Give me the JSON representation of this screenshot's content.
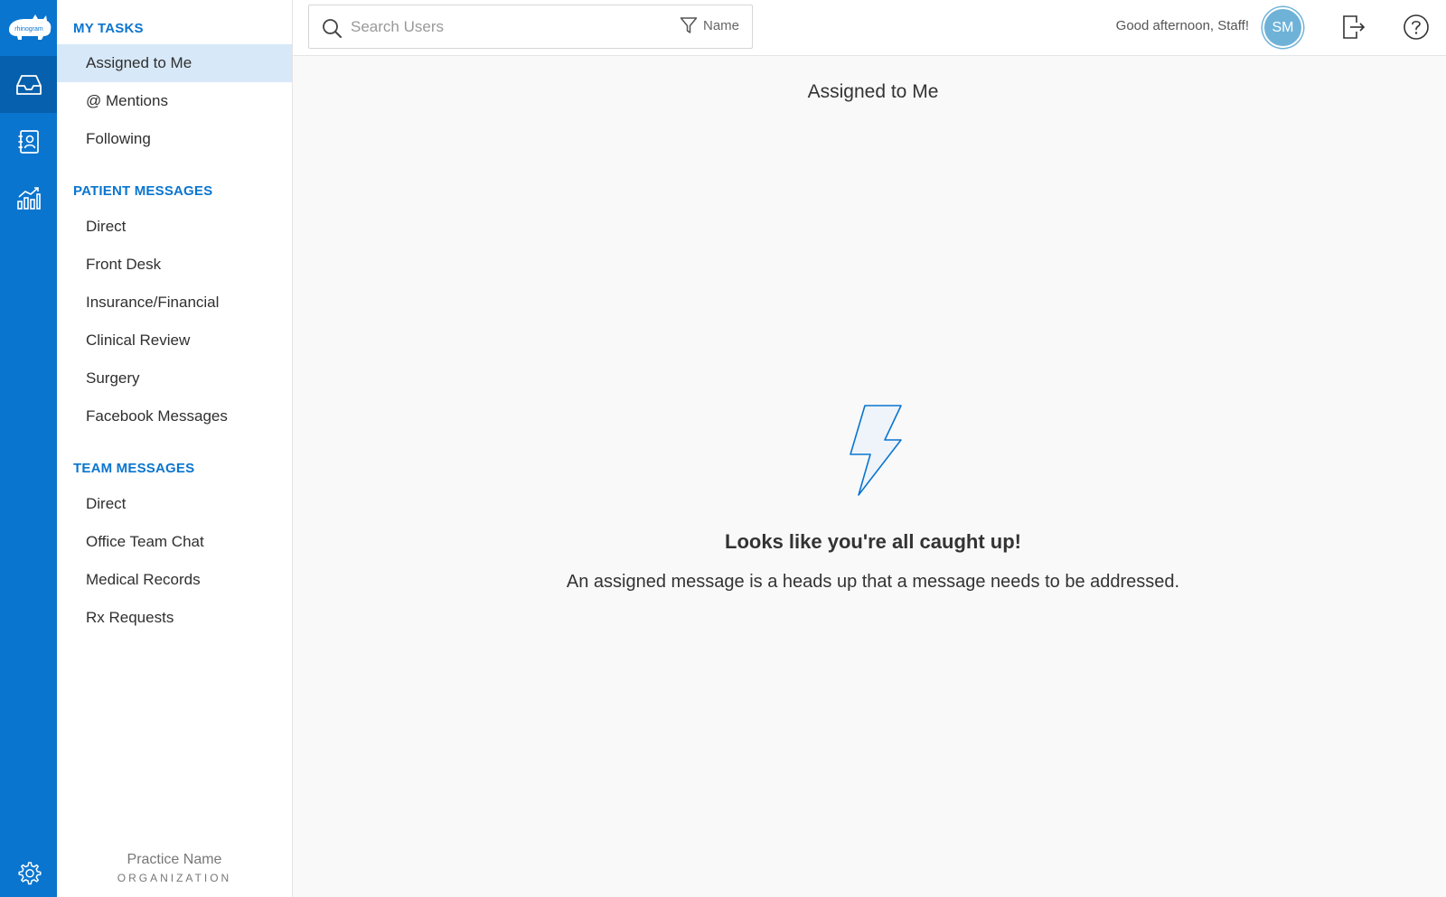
{
  "brand": {
    "logo_text": "rhinogram",
    "accent": "#0a75cf",
    "rail_active": "#0660ad",
    "active_item_bg": "#d7e8f8"
  },
  "rail": {
    "items": [
      {
        "icon": "inbox-icon",
        "active": true
      },
      {
        "icon": "contacts-icon",
        "active": false
      },
      {
        "icon": "analytics-icon",
        "active": false
      }
    ],
    "bottom_icon": "gear-icon"
  },
  "sidebar": {
    "my_tasks": {
      "heading": "MY TASKS",
      "items": [
        "Assigned to Me",
        "@ Mentions",
        "Following"
      ],
      "active": "Assigned to Me"
    },
    "patient_messages": {
      "heading": "PATIENT MESSAGES",
      "items": [
        "Direct",
        "Front Desk",
        "Insurance/Financial",
        "Clinical Review",
        "Surgery",
        "Facebook Messages"
      ]
    },
    "team_messages": {
      "heading": "TEAM MESSAGES",
      "items": [
        "Direct",
        "Office Team Chat",
        "Medical Records",
        "Rx Requests"
      ]
    },
    "footer": {
      "practice_name": "Practice Name",
      "org_label": "ORGANIZATION"
    }
  },
  "topbar": {
    "search_placeholder": "Search Users",
    "filter_label": "Name",
    "greeting": "Good afternoon, Staff!",
    "avatar_initials": "SM",
    "avatar_color": "#6fb2d8",
    "icons": [
      "logout-icon",
      "help-icon"
    ]
  },
  "main": {
    "title": "Assigned to Me",
    "empty_heading": "Looks like you're all caught up!",
    "empty_text": "An assigned message is a heads up that a message needs to be addressed.",
    "empty_icon": "lightning-bolt-icon"
  }
}
